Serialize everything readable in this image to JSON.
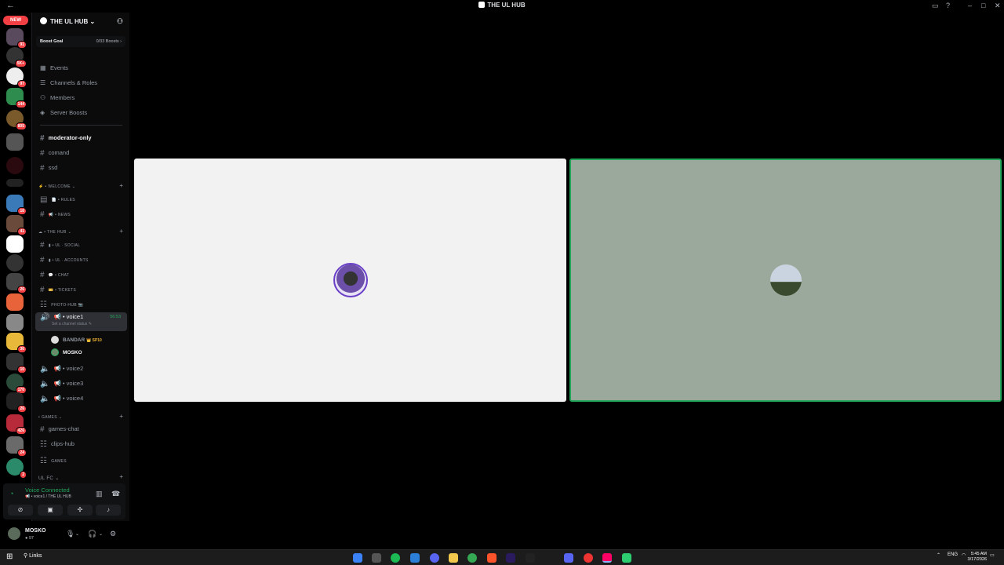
{
  "window": {
    "title": "THE UL HUB"
  },
  "servers": {
    "new_label": "NEW",
    "counts": [
      "91",
      "5K+",
      "97",
      "144",
      "805",
      "",
      "",
      "",
      "16",
      "41",
      "",
      "",
      "26",
      "",
      "",
      "36",
      "10",
      "170",
      "26",
      "426",
      "24",
      "2"
    ]
  },
  "server": {
    "name": "THE UL HUB",
    "boost_label": "Boost Goal",
    "boost_value": "0/33 Boosts"
  },
  "nav": [
    "Events",
    "Channels & Roles",
    "Members",
    "Server Boosts"
  ],
  "channels": {
    "moderator": "moderator-only",
    "comand": "comand",
    "ssd": "ssd",
    "cat_welcome": "WELCOME",
    "rules": "RULES",
    "news": "NEWS",
    "cat_hub": "THE HUB",
    "social": "UL ᐧ SOCIAL",
    "accounts": "UL ᐧ ACCOUNTS",
    "chat": "CHAT",
    "tickets": "TICKETS",
    "photohub": "PHOTO-HUB",
    "voice1": "voice1",
    "voice1_timer": "56:53",
    "voice1_status": "Set a channel status",
    "member1": "BANDAR",
    "member1_tag": "SP10",
    "member2": "MOSKO",
    "voice2": "voice2",
    "voice3": "voice3",
    "voice4": "voice4",
    "cat_games": "GAMES",
    "games_chat": "games-chat",
    "clips_hub": "clips-hub",
    "games": "GAMES",
    "cat_ulfc": "UL FC"
  },
  "voice": {
    "connected": "Voice Connected",
    "location": "voice1 / THE UL HUB"
  },
  "user": {
    "name": "MOSKO",
    "status": "97"
  },
  "taskbar": {
    "search": "Links",
    "lang": "ENG",
    "time": "5:45 AM",
    "date": "3/17/2026"
  },
  "colors": {
    "accent_green": "#23a55a",
    "badge_red": "#f23f43",
    "tile_left": "#f2f2f2",
    "tile_right": "#9aa99c"
  }
}
